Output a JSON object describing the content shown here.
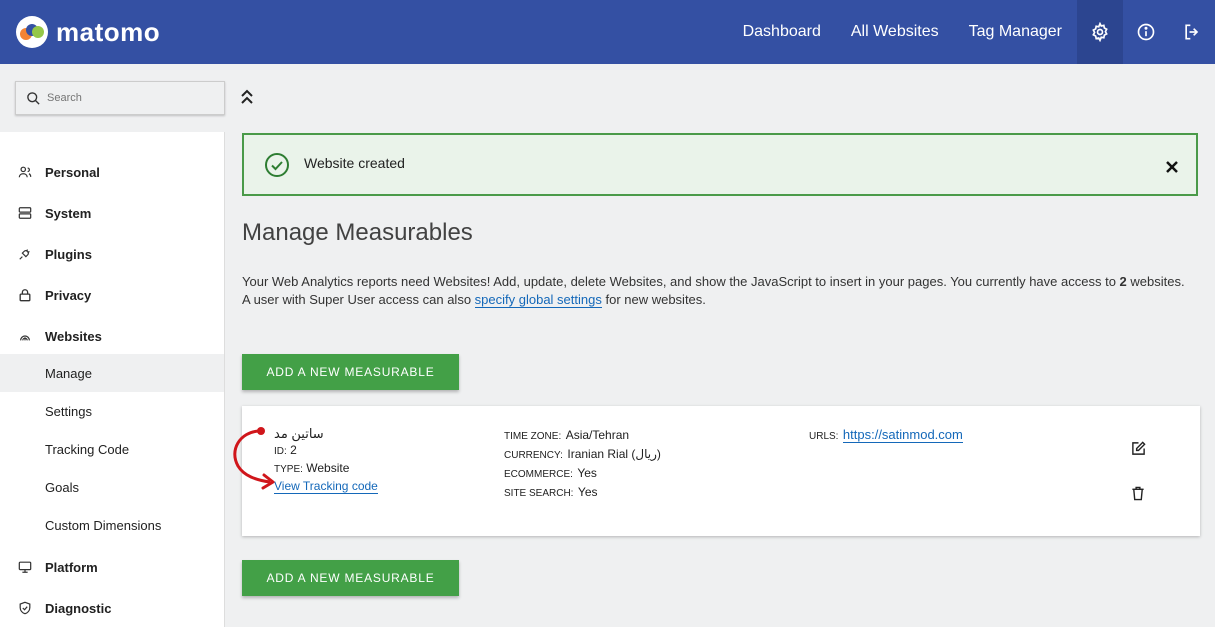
{
  "header": {
    "brand": "matomo",
    "nav": [
      "Dashboard",
      "All Websites",
      "Tag Manager"
    ]
  },
  "sidebar": {
    "search_placeholder": "Search",
    "items": {
      "personal": "Personal",
      "system": "System",
      "plugins": "Plugins",
      "privacy": "Privacy",
      "websites": "Websites",
      "manage": "Manage",
      "settings": "Settings",
      "tracking_code": "Tracking Code",
      "goals": "Goals",
      "custom_dimensions": "Custom Dimensions",
      "platform": "Platform",
      "diagnostic": "Diagnostic"
    }
  },
  "notification": {
    "message": "Website created"
  },
  "main": {
    "title": "Manage Measurables",
    "intro_part1": "Your Web Analytics reports need Websites! Add, update, delete Websites, and show the JavaScript to insert in your pages. You currently have access to ",
    "intro_count": "2",
    "intro_part2": " websites.",
    "intro_line2_a": "A user with Super User access can also ",
    "intro_link": "specify global settings",
    "intro_line2_b": " for new websites.",
    "add_button": "ADD A NEW MEASURABLE"
  },
  "site": {
    "name": "ساتین مد",
    "id_label": "ID:",
    "id": "2",
    "type_label": "TYPE:",
    "type": "Website",
    "tracking_link": "View Tracking code",
    "timezone_label": "TIME ZONE:",
    "timezone": "Asia/Tehran",
    "currency_label": "CURRENCY:",
    "currency": "Iranian Rial (ریال)",
    "ecommerce_label": "ECOMMERCE:",
    "ecommerce": "Yes",
    "sitesearch_label": "SITE SEARCH:",
    "sitesearch": "Yes",
    "urls_label": "URLS:",
    "url": "https://satinmod.com"
  },
  "colors": {
    "header_bg": "#3450a3",
    "button_green": "#43a047",
    "notice_border": "#4a9a49",
    "link_blue": "#1468b9",
    "annotation_red": "#d0161b"
  }
}
